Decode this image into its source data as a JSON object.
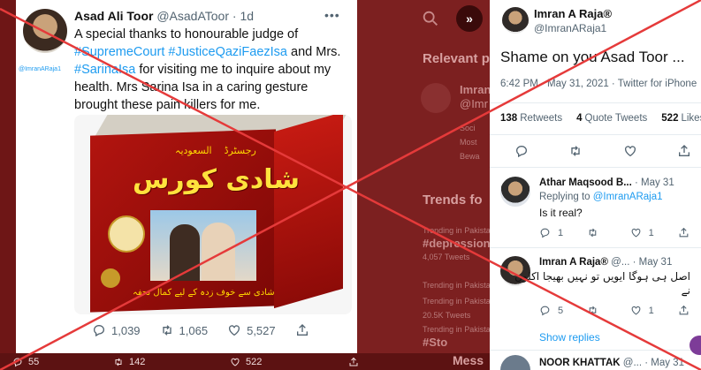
{
  "left_tweet": {
    "author_name": "Asad Ali Toor",
    "author_handle": "@AsadAToor",
    "separator": "·",
    "age": "1d",
    "watermark_handle": "@ImranARaja1",
    "text_1": "A special thanks to honourable judge of ",
    "hashtag_1": "#SupremeCourt",
    "space_1": " ",
    "hashtag_2": "#JusticeQaziFaezIsa",
    "text_2": " and Mrs. ",
    "hashtag_3": "#SarinaIsa",
    "text_3": " for visiting me to inquire about my health. Mrs Sarina Isa in a caring gesture brought these pain killers for me.",
    "product": {
      "small_label_1": "السعودیہ",
      "small_label_2": "رجسٹرڈ",
      "title": "شادی کورس",
      "subtitle": "شادی سے خوف زدہ کے لیے کمال تحفہ"
    },
    "actions": {
      "replies": "1,039",
      "retweets": "1,065",
      "likes": "5,527"
    }
  },
  "bottom_strip": {
    "replies": "55",
    "retweets": "142",
    "likes": "522"
  },
  "middle_panel": {
    "relevant_label": "Relevant p",
    "name_fragment": "Imran",
    "handle_fragment": "@Imr",
    "bio_1": "Soci",
    "bio_2": "Most",
    "bio_3": "Bewa",
    "trends_label": "Trends fo",
    "trend_1_meta": "Trending in Pakistan",
    "trend_1_tag": "#depression",
    "trend_1_count": "4,057 Tweets",
    "trend_2_meta": "Trending in Pakistan",
    "trend_3_meta": "Trending in Pakistan",
    "trend_3_count": "20.5K Tweets",
    "trend_4_meta": "Trending in Pakistan",
    "trend_4_tag": "#Sto",
    "messages_label": "Mess"
  },
  "right_tweet": {
    "author_name": "Imran A Raja®",
    "author_handle": "@ImranARaja1",
    "text": "Shame on you Asad Toor ...",
    "timestamp": "6:42 PM · May 31, 2021 · Twitter for iPhone",
    "retweets_count": "138",
    "retweets_label": "Retweets",
    "quotes_count": "4",
    "quotes_label": "Quote Tweets",
    "likes_count": "522",
    "likes_label": "Likes"
  },
  "replies": [
    {
      "name": "Athar Maqsood B...",
      "date": "· May 31",
      "replying_prefix": "Replying to ",
      "replying_to": "@ImranARaja1",
      "text": "Is it real?",
      "replies": "1",
      "retweets": "",
      "likes": "1"
    },
    {
      "name": "Imran A Raja®",
      "handle": "@...",
      "date": "· May 31",
      "text_line_1": "اصل ہی ہوگا ایویں تو نہیں بھیجا اکلوں",
      "text_line_2": "نے",
      "replies": "5",
      "retweets": "",
      "likes": "1"
    },
    {
      "name": "NOOR KHATTAK",
      "handle": "@...",
      "date": "· May 31"
    }
  ],
  "show_replies_label": "Show replies",
  "colors": {
    "link": "#1d9bf0",
    "overlay_x": "#e53a3a",
    "backdrop": "#6e1616"
  }
}
